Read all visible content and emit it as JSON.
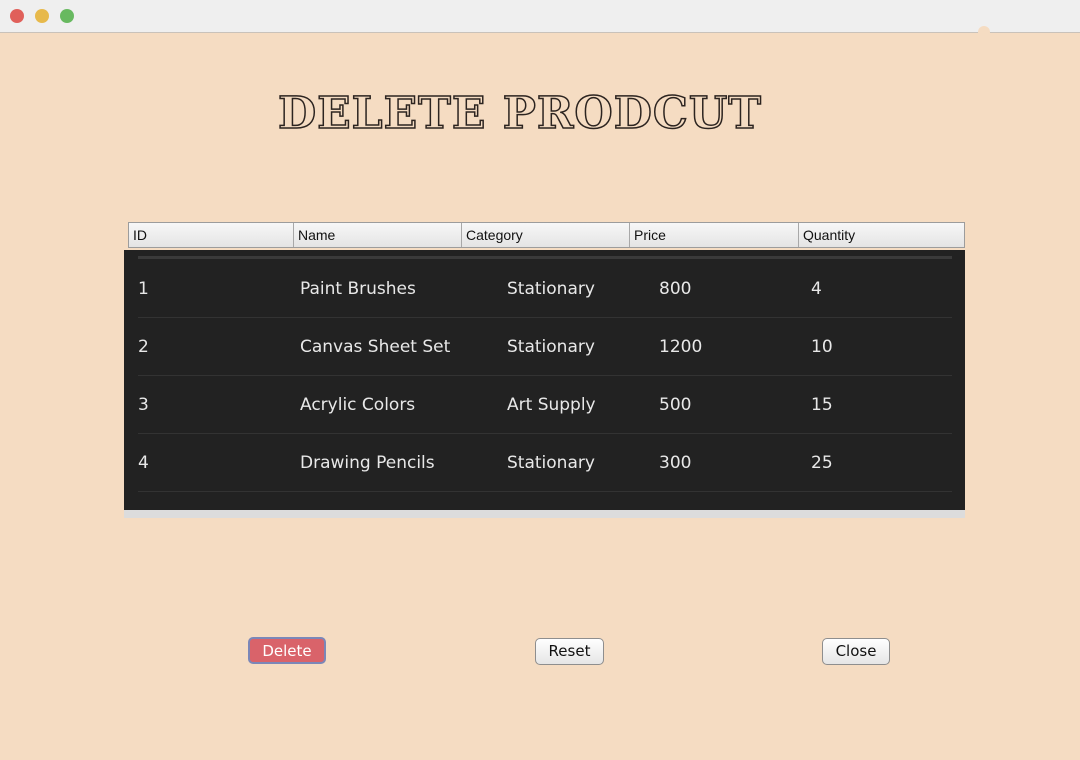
{
  "page": {
    "title": "DELETE PRODCUT"
  },
  "table": {
    "columns": [
      "ID",
      "Name",
      "Category",
      "Price",
      "Quantity"
    ],
    "rows": [
      {
        "id": "1",
        "name": "Paint Brushes",
        "category": "Stationary",
        "price": "800",
        "quantity": "4"
      },
      {
        "id": "2",
        "name": "Canvas Sheet Set",
        "category": "Stationary",
        "price": "1200",
        "quantity": "10"
      },
      {
        "id": "3",
        "name": "Acrylic Colors",
        "category": "Art Supply",
        "price": "500",
        "quantity": "15"
      },
      {
        "id": "4",
        "name": "Drawing Pencils",
        "category": "Stationary",
        "price": "300",
        "quantity": "25"
      }
    ]
  },
  "buttons": {
    "delete": "Delete",
    "reset": "Reset",
    "close": "Close"
  },
  "colors": {
    "background": "#f5dcc2",
    "table_body": "#222222",
    "delete_button": "#d9636a"
  }
}
